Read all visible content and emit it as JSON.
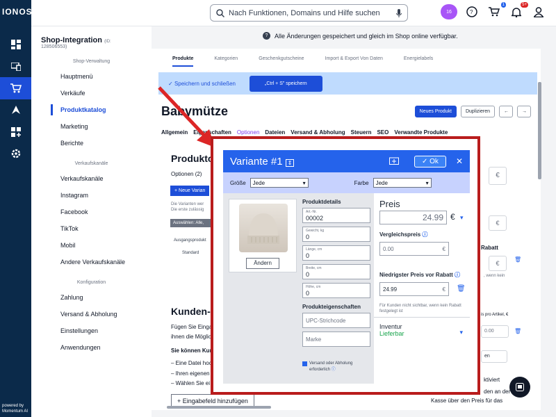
{
  "rail": {
    "logo": "IONOS",
    "powered_line1": "powered by",
    "powered_line2": "Momentum AI"
  },
  "topbar": {
    "search_placeholder": "Nach Funktionen, Domains und Hilfe suchen",
    "ai_badge": "16",
    "cart_badge": "1",
    "notif_badge": "5+"
  },
  "notice": "Alle Änderungen gespeichert und gleich im Shop online verfügbar.",
  "sidebar": {
    "title": "Shop-Integration",
    "id_suffix": "(ID:",
    "id_value": "128506553)",
    "sections": [
      {
        "heading": "Shop-Verwaltung",
        "items": [
          "Hauptmenü",
          "Verkäufe",
          "Produktkatalog",
          "Marketing",
          "Berichte"
        ]
      },
      {
        "heading": "Verkaufskanäle",
        "items": [
          "Verkaufskanäle",
          "Instagram",
          "Facebook",
          "TikTok",
          "Mobil",
          "Andere Verkaufskanäle"
        ]
      },
      {
        "heading": "Konfiguration",
        "items": [
          "Zahlung",
          "Versand & Abholung",
          "Einstellungen",
          "Anwendungen"
        ]
      }
    ]
  },
  "tabs": [
    "Produkte",
    "Kategorien",
    "Geschenkgutscheine",
    "Import & Export Von Daten",
    "Energielabels"
  ],
  "savebar": {
    "save_close": "Speichern und schließen",
    "ctrl_save": "„Ctrl + S\" speichern"
  },
  "product": {
    "title": "Babymütze",
    "new_product": "Neues Produkt",
    "duplicate": "Duplizieren",
    "subtabs": [
      "Allgemein",
      "Eigenschaften",
      "Optionen",
      "Dateien",
      "Versand & Abholung",
      "Steuern",
      "SEO",
      "Verwandte Produkte"
    ]
  },
  "background": {
    "produkt_heading": "Produkto",
    "optionen": "Optionen (2)",
    "neue_variante": "Neue Varian",
    "hint1": "Die Varianten wer",
    "hint2": "Die erste zulässig",
    "auswahlen": "Auswählen: Alle,",
    "ausgangsprodukt": "Ausgangsprodukt",
    "standard": "Standard",
    "kunden_heading": "Kunden-E",
    "fuegen": "Fügen Sie Eingal",
    "ihnen": "ihnen die Möglich",
    "sie_koennen": "Sie können Kund",
    "li1": "– Eine Datei hoc",
    "li2": "– Ihren eigenen",
    "li3": "– Wählen Sie ei",
    "add_field": "Eingabefeld hinzufügen",
    "rabatt": "Rabatt",
    "wenn_kein": ", wenn kein",
    "preis_artikel": "is pro Artikel, €",
    "preis_val": "0.00",
    "en": "en",
    "aktiviert": "ktiviert",
    "den_an": "den an der",
    "kasse": "Kasse über den Preis für das",
    "euro": "€"
  },
  "modal": {
    "title": "Variante #1",
    "ok": "Ok",
    "groesse_label": "Größe",
    "groesse_value": "Jede",
    "farbe_label": "Farbe",
    "farbe_value": "Jede",
    "change_image": "Ändern",
    "details_heading": "Produktdetails",
    "fields": [
      {
        "label": "Art.-Nr.",
        "value": "00002"
      },
      {
        "label": "Gewicht, kg",
        "value": "0"
      },
      {
        "label": "Länge, cm",
        "value": "0"
      },
      {
        "label": "Breite, cm",
        "value": "0"
      },
      {
        "label": "Höhe, cm",
        "value": "0"
      }
    ],
    "props_heading": "Produkteigenschaften",
    "upc_placeholder": "UPC-Strichcode",
    "brand_placeholder": "Marke",
    "shipping_line1": "Versand oder Abholung",
    "shipping_line2": "erforderlich",
    "price_heading": "Preis",
    "price_value": "24.99",
    "currency": "€",
    "compare_label": "Vergleichspreis",
    "compare_value": "0.00",
    "lowest_label": "Niedrigster Preis vor Rabatt",
    "lowest_value": "24.99",
    "note": "Für Kunden nicht sichtbar, wenn kein Rabatt festgelegt ist",
    "inventory_label": "Inventur",
    "inventory_value": "Lieferbar"
  }
}
